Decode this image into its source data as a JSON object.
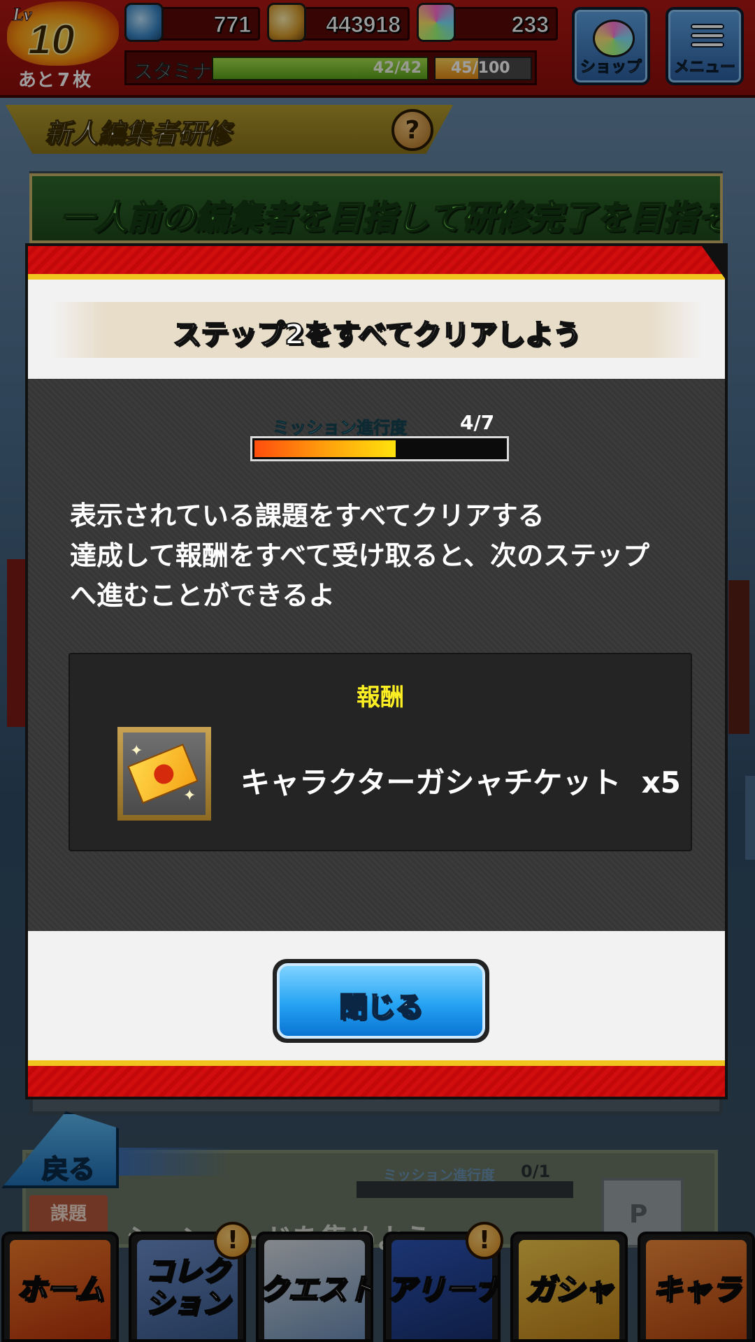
{
  "hud": {
    "level_label": "Lv",
    "level": "10",
    "remaining_prefix": "あと",
    "remaining_count": "7",
    "remaining_suffix": "枚",
    "gems": "771",
    "coins": "443918",
    "orbs": "233",
    "stamina_label": "スタミナ",
    "stamina_value": "42/42",
    "exp_value": "45/100",
    "exp_progress": 0.45,
    "shop_label": "ショップ",
    "menu_label": "メニュー",
    "icons": {
      "gems": "blue-gem-icon",
      "coins": "gold-coin-icon",
      "orbs": "rainbow-orb-icon",
      "shop": "rainbow-orb-icon",
      "menu": "hamburger-menu-icon"
    }
  },
  "page": {
    "title": "新人編集者研修",
    "help": "?",
    "banner": "一人前の編集者を目指して研修完了を目指そう！"
  },
  "modal": {
    "heading": "ステップ2をすべてクリアしよう",
    "progress_label": "ミッション進行度",
    "progress_value": "4/7",
    "progress_ratio": 0.571,
    "description": [
      "表示されている課題をすべてクリアする",
      "達成して報酬をすべて受け取ると、次のステップ",
      "へ進むことができるよ"
    ],
    "reward_title": "報酬",
    "reward_name": "キャラクターガシャチケット",
    "reward_qty": "x5",
    "reward_icon": "gacha-ticket-icon",
    "close_label": "閉じる"
  },
  "background_card": {
    "tag": "課題",
    "text": "シーン…ードを集めよう",
    "progress_label": "ミッション進行度",
    "progress_value": "0/1"
  },
  "back_label": "戻る",
  "nav": [
    {
      "label": "ホーム",
      "alert": false
    },
    {
      "label": "コレクション",
      "line1": "コレク",
      "line2": "ション",
      "alert": true
    },
    {
      "label": "クエスト",
      "alert": false
    },
    {
      "label": "アリーナ",
      "alert": true
    },
    {
      "label": "ガシャ",
      "alert": false
    },
    {
      "label": "キャラ",
      "alert": false
    }
  ],
  "colors": {
    "hud_red": "#b11813",
    "progress_cyan": "#5ed2f0",
    "reward_yellow": "#fbee22",
    "button_blue": "#25a3f3"
  }
}
